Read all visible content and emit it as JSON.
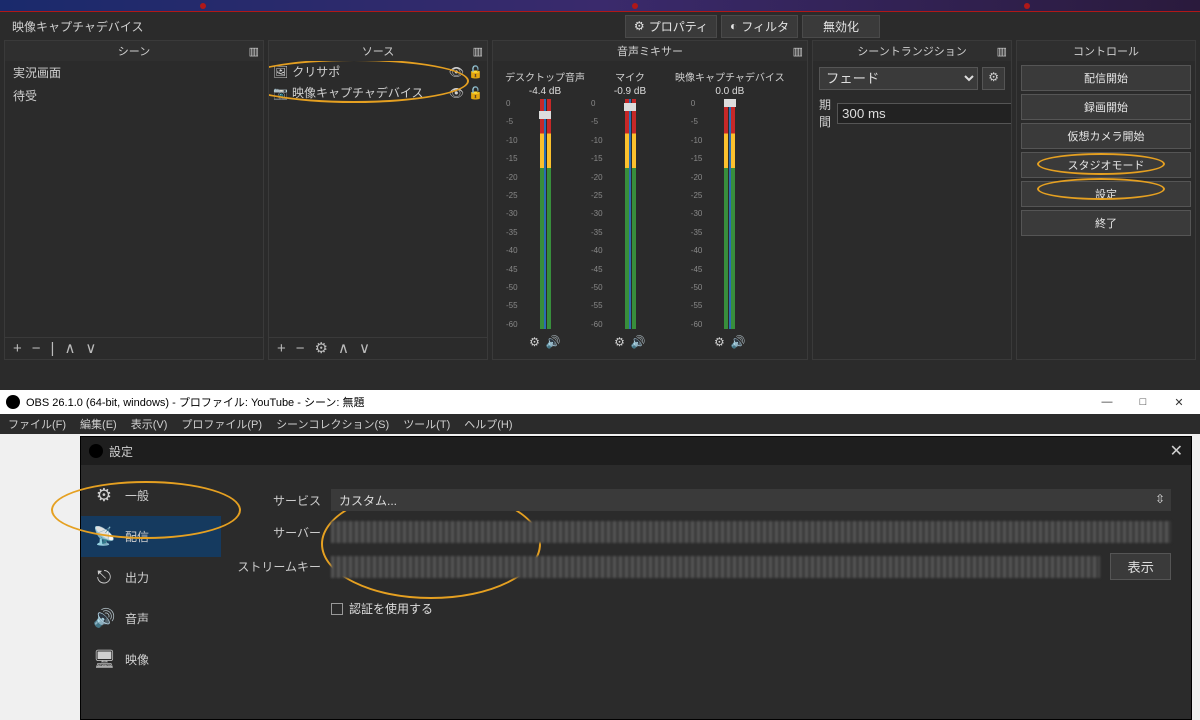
{
  "top": {
    "selected_source": "映像キャプチャデバイス",
    "tool": {
      "properties": "プロパティ",
      "filters": "フィルタ",
      "disable": "無効化"
    },
    "docks": {
      "scenes": {
        "title": "シーン",
        "items": [
          "実況画面",
          "待受"
        ]
      },
      "sources": {
        "title": "ソース",
        "items": [
          {
            "icon": "image-icon",
            "label": "クリサポ"
          },
          {
            "icon": "camera-icon",
            "label": "映像キャプチャデバイス"
          }
        ]
      },
      "mixer": {
        "title": "音声ミキサー",
        "channels": [
          {
            "name": "デスクトップ音声",
            "db": "-4.4 dB",
            "knob": 12
          },
          {
            "name": "マイク",
            "db": "-0.9 dB",
            "knob": 4
          },
          {
            "name": "映像キャプチャデバイス",
            "db": "0.0 dB",
            "knob": 0
          }
        ],
        "ticks": [
          "0",
          "-5",
          "-10",
          "-15",
          "-20",
          "-25",
          "-30",
          "-35",
          "-40",
          "-45",
          "-50",
          "-55",
          "-60"
        ]
      },
      "transitions": {
        "title": "シーントランジション",
        "selected": "フェード",
        "duration_label": "期間",
        "duration_value": "300 ms"
      },
      "controls": {
        "title": "コントロール",
        "buttons": [
          "配信開始",
          "録画開始",
          "仮想カメラ開始",
          "スタジオモード",
          "設定",
          "終了"
        ]
      }
    }
  },
  "bottom": {
    "window_title": "OBS 26.1.0 (64-bit, windows) - プロファイル: YouTube - シーン: 無題",
    "menubar": [
      "ファイル(F)",
      "編集(E)",
      "表示(V)",
      "プロファイル(P)",
      "シーンコレクション(S)",
      "ツール(T)",
      "ヘルプ(H)"
    ],
    "settings_title": "設定",
    "sidebar": [
      {
        "icon": "gear-icon",
        "label": "一般"
      },
      {
        "icon": "antenna-icon",
        "label": "配信"
      },
      {
        "icon": "output-icon",
        "label": "出力"
      },
      {
        "icon": "speaker-icon",
        "label": "音声"
      },
      {
        "icon": "monitor-icon",
        "label": "映像"
      }
    ],
    "form": {
      "service_label": "サービス",
      "service_value": "カスタム...",
      "server_label": "サーバー",
      "key_label": "ストリームキー",
      "show": "表示",
      "auth": "認証を使用する"
    }
  }
}
